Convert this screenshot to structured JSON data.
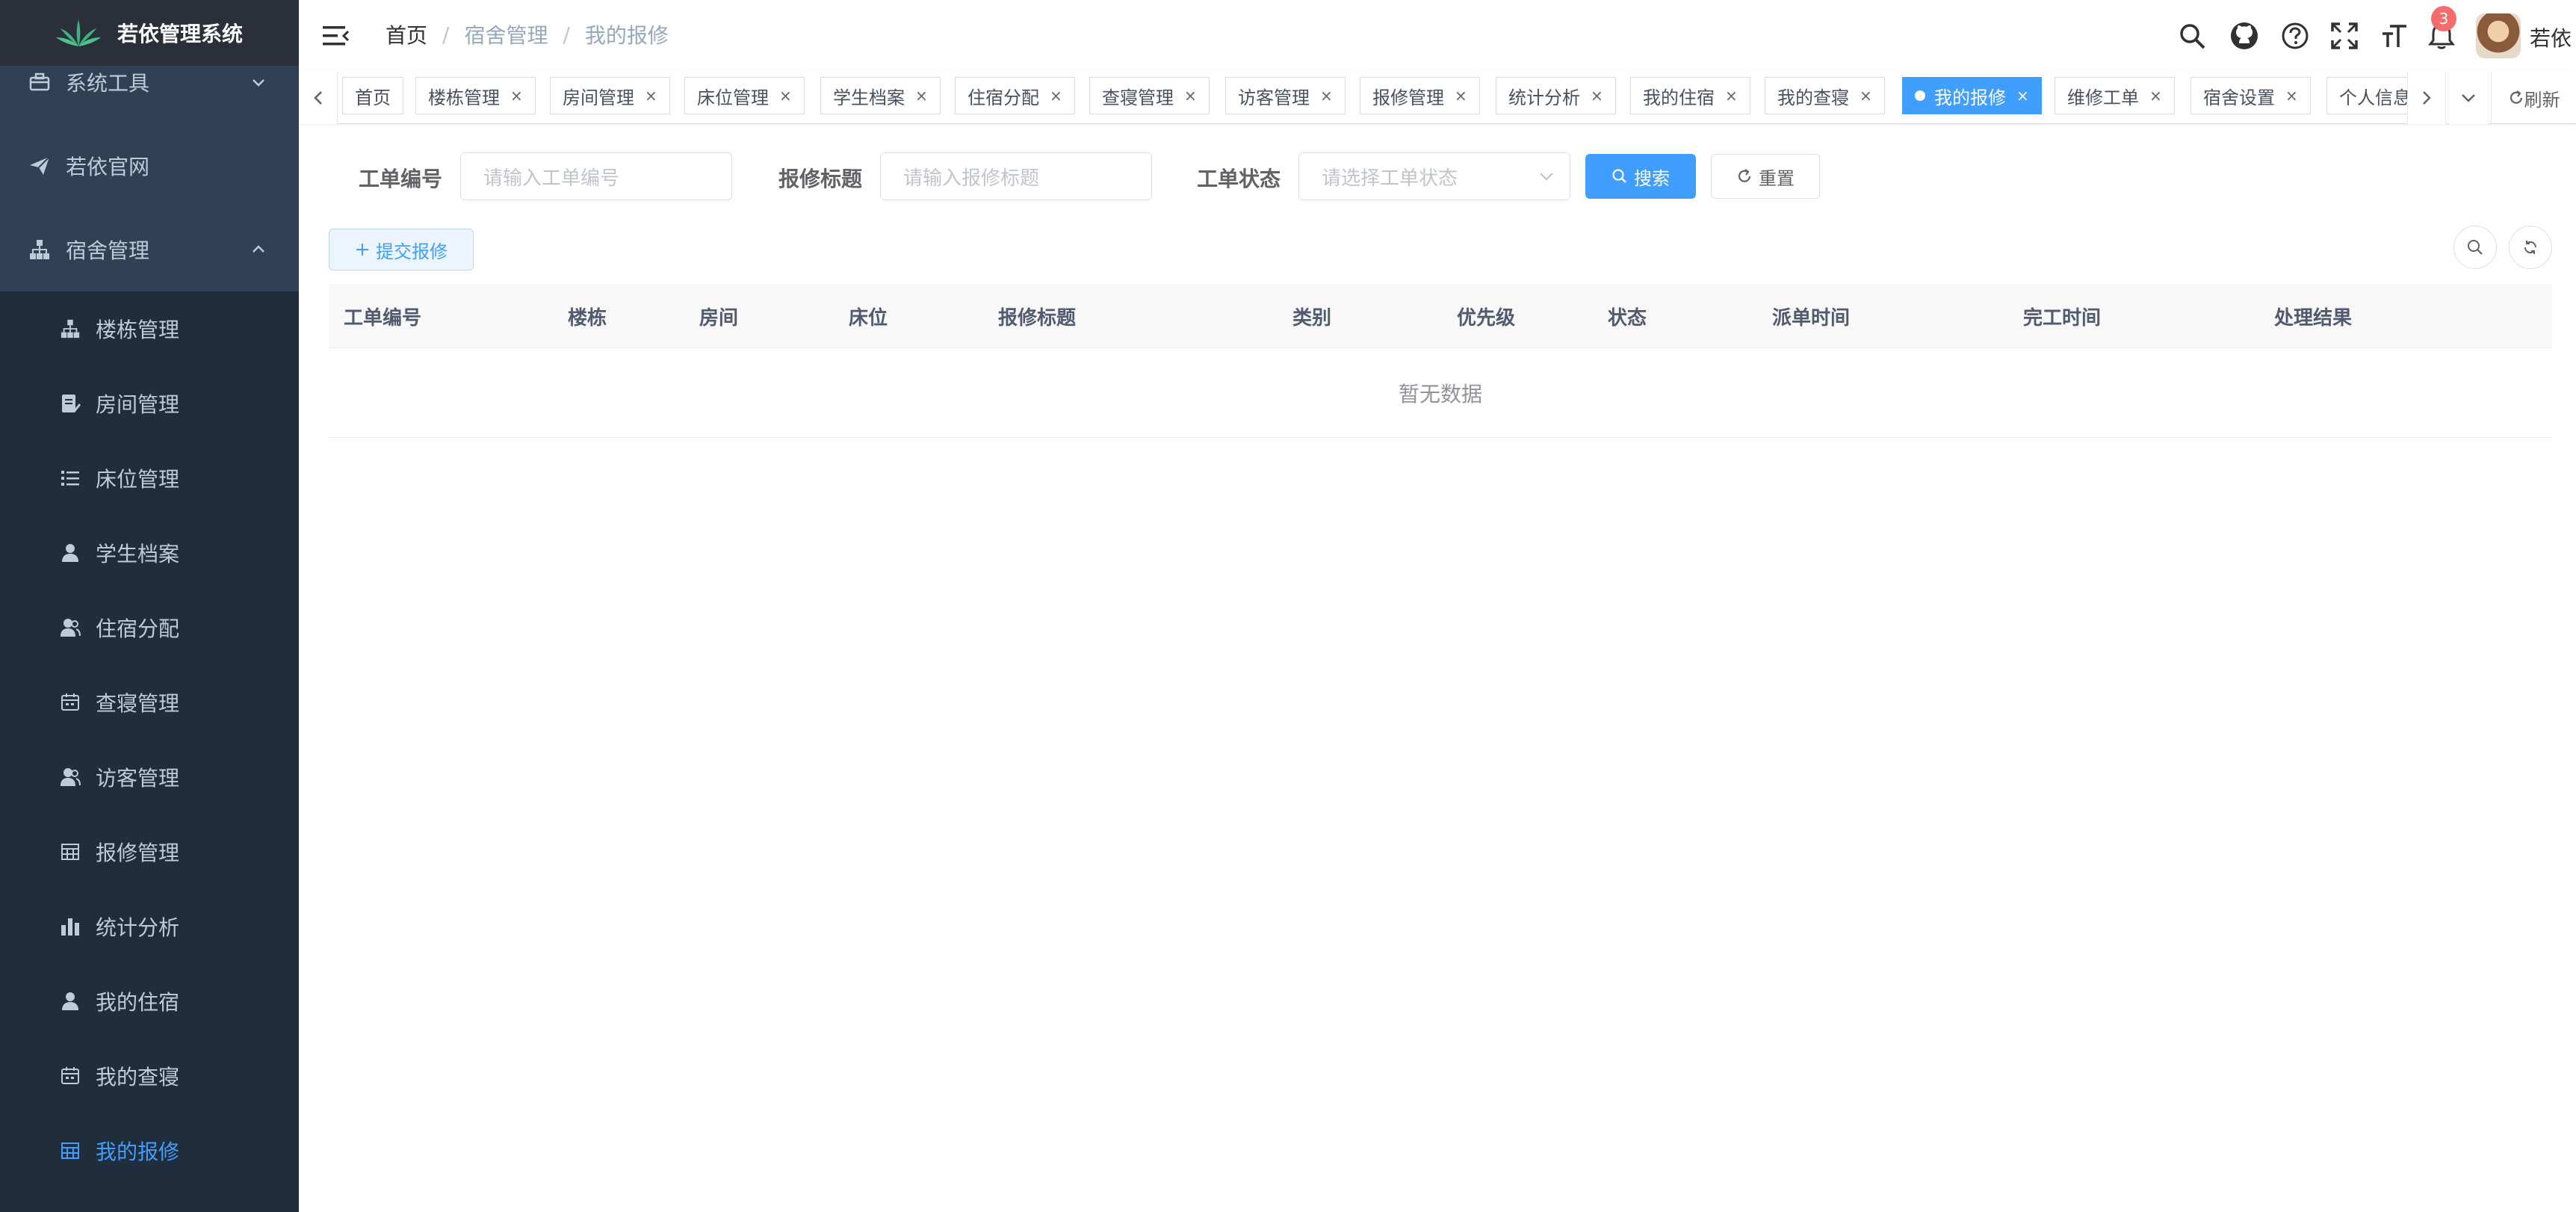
{
  "app": {
    "title": "若依管理系统"
  },
  "sidebar": {
    "top_items": [
      {
        "label": "系统工具",
        "icon": "toolbox-icon"
      },
      {
        "label": "若依官网",
        "icon": "send-icon"
      },
      {
        "label": "宿舍管理",
        "icon": "tree-icon"
      }
    ],
    "sub_items": [
      {
        "label": "楼栋管理",
        "icon": "tree-icon"
      },
      {
        "label": "房间管理",
        "icon": "edit-doc-icon"
      },
      {
        "label": "床位管理",
        "icon": "list-icon"
      },
      {
        "label": "学生档案",
        "icon": "user-icon"
      },
      {
        "label": "住宿分配",
        "icon": "peoples-icon"
      },
      {
        "label": "查寝管理",
        "icon": "date-icon"
      },
      {
        "label": "访客管理",
        "icon": "peoples-icon"
      },
      {
        "label": "报修管理",
        "icon": "table-icon"
      },
      {
        "label": "统计分析",
        "icon": "chart-icon"
      },
      {
        "label": "我的住宿",
        "icon": "user-icon"
      },
      {
        "label": "我的查寝",
        "icon": "date-icon"
      },
      {
        "label": "我的报修",
        "icon": "table-icon",
        "active": true
      }
    ]
  },
  "navbar": {
    "breadcrumb": [
      "首页",
      "宿舍管理",
      "我的报修"
    ],
    "notification_count": "3",
    "user_name": "若依"
  },
  "tags": {
    "items": [
      {
        "label": "首页",
        "closable": false
      },
      {
        "label": "楼栋管理",
        "closable": true
      },
      {
        "label": "房间管理",
        "closable": true
      },
      {
        "label": "床位管理",
        "closable": true
      },
      {
        "label": "学生档案",
        "closable": true
      },
      {
        "label": "住宿分配",
        "closable": true
      },
      {
        "label": "查寝管理",
        "closable": true
      },
      {
        "label": "访客管理",
        "closable": true
      },
      {
        "label": "报修管理",
        "closable": true
      },
      {
        "label": "统计分析",
        "closable": true
      },
      {
        "label": "我的住宿",
        "closable": true
      },
      {
        "label": "我的查寝",
        "closable": true
      },
      {
        "label": "我的报修",
        "closable": true,
        "active": true
      },
      {
        "label": "维修工单",
        "closable": true
      },
      {
        "label": "宿舍设置",
        "closable": true
      },
      {
        "label": "个人信息",
        "closable": false
      }
    ],
    "close_symbol": "×",
    "refresh_label": "刷新"
  },
  "search": {
    "order_no": {
      "label": "工单编号",
      "placeholder": "请输入工单编号"
    },
    "title": {
      "label": "报修标题",
      "placeholder": "请输入报修标题"
    },
    "status": {
      "label": "工单状态",
      "placeholder": "请选择工单状态"
    },
    "search_button": "搜索",
    "reset_button": "重置"
  },
  "toolbar": {
    "submit_button": "提交报修"
  },
  "table": {
    "columns": [
      "工单编号",
      "楼栋",
      "房间",
      "床位",
      "报修标题",
      "类别",
      "优先级",
      "状态",
      "派单时间",
      "完工时间",
      "处理结果"
    ],
    "empty_text": "暂无数据"
  },
  "colors": {
    "sidebar_bg": "#304156",
    "submenu_bg": "#1f2d3d",
    "accent": "#409eff",
    "badge": "#f56c6c"
  }
}
